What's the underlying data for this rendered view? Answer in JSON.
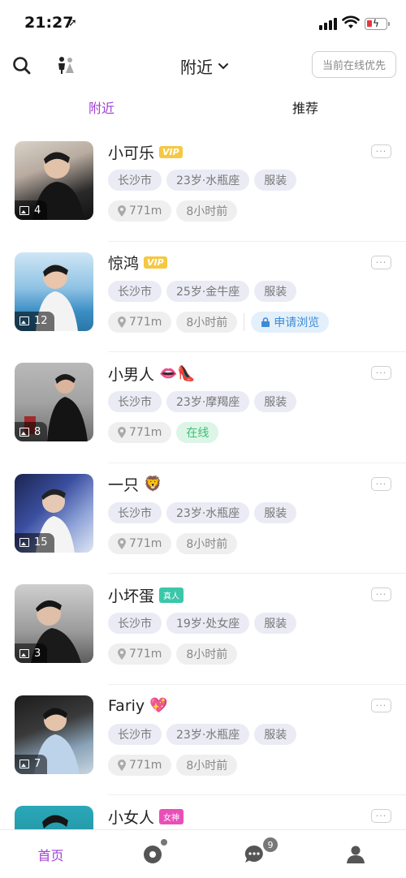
{
  "status_bar": {
    "time": "21:27",
    "location_arrow": "➚"
  },
  "nav": {
    "title": "附近",
    "online_first_label": "当前在线优先"
  },
  "tabs": [
    {
      "label": "附近",
      "active": true
    },
    {
      "label": "推荐",
      "active": false
    }
  ],
  "users": [
    {
      "name": "小可乐",
      "badge": "VIP",
      "emoji": "",
      "photo_count": "4",
      "city": "长沙市",
      "age_sign": "23岁·水瓶座",
      "job": "服装",
      "distance": "771m",
      "last_seen": "8小时前",
      "extra": ""
    },
    {
      "name": "惊鸿",
      "badge": "VIP",
      "emoji": "",
      "photo_count": "12",
      "city": "长沙市",
      "age_sign": "25岁·金牛座",
      "job": "服装",
      "distance": "771m",
      "last_seen": "8小时前",
      "extra": "申请浏览"
    },
    {
      "name": "小男人",
      "badge": "",
      "emoji": "👄👠",
      "photo_count": "8",
      "city": "长沙市",
      "age_sign": "23岁·摩羯座",
      "job": "服装",
      "distance": "771m",
      "last_seen": "在线",
      "extra": ""
    },
    {
      "name": "一只",
      "badge": "",
      "emoji": "🦁",
      "photo_count": "15",
      "city": "长沙市",
      "age_sign": "23岁·水瓶座",
      "job": "服装",
      "distance": "771m",
      "last_seen": "8小时前",
      "extra": ""
    },
    {
      "name": "小坏蛋",
      "badge": "真人",
      "emoji": "",
      "photo_count": "3",
      "city": "长沙市",
      "age_sign": "19岁·处女座",
      "job": "服装",
      "distance": "771m",
      "last_seen": "8小时前",
      "extra": ""
    },
    {
      "name": "Fariy",
      "badge": "",
      "emoji": "💖",
      "photo_count": "7",
      "city": "长沙市",
      "age_sign": "23岁·水瓶座",
      "job": "服装",
      "distance": "771m",
      "last_seen": "8小时前",
      "extra": ""
    },
    {
      "name": "小女人",
      "badge": "女神",
      "emoji": "",
      "photo_count": "",
      "city": "",
      "age_sign": "",
      "job": "",
      "distance": "",
      "last_seen": "",
      "extra": ""
    }
  ],
  "more_label": "···",
  "bottom_nav": {
    "home": "首页",
    "messages_badge": "9"
  },
  "colors": {
    "accent": "#a23fd6",
    "vip": "#f5c842",
    "online": "#3cbf77",
    "apply": "#3d8bd6"
  }
}
